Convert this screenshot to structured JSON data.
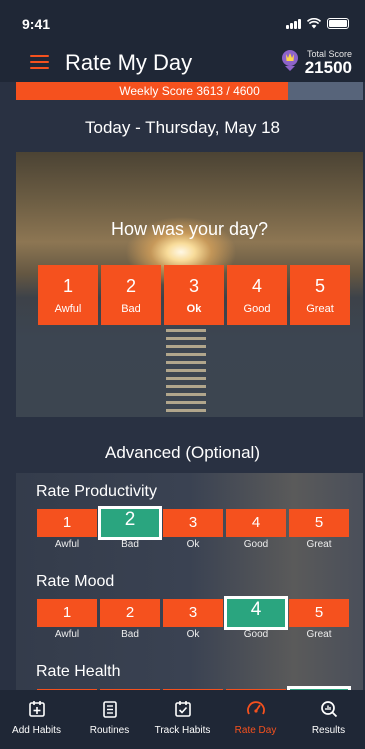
{
  "status": {
    "time": "9:41"
  },
  "header": {
    "title": "Rate My Day",
    "score_label": "Total Score",
    "score_value": "21500"
  },
  "weekly": {
    "label": "Weekly Score  3613 / 4600",
    "progress": 0.785
  },
  "today": "Today - Thursday, May 18",
  "hero": {
    "question": "How was your day?",
    "selected": 3,
    "ratings": [
      {
        "num": "1",
        "label": "Awful"
      },
      {
        "num": "2",
        "label": "Bad"
      },
      {
        "num": "3",
        "label": "Ok"
      },
      {
        "num": "4",
        "label": "Good"
      },
      {
        "num": "5",
        "label": "Great"
      }
    ]
  },
  "advanced": "Advanced (Optional)",
  "sections": [
    {
      "title": "Rate Productivity",
      "selected": 2,
      "nums": [
        "1",
        "2",
        "3",
        "4",
        "5"
      ],
      "labels": [
        "Awful",
        "Bad",
        "Ok",
        "Good",
        "Great"
      ]
    },
    {
      "title": "Rate Mood",
      "selected": 4,
      "nums": [
        "1",
        "2",
        "3",
        "4",
        "5"
      ],
      "labels": [
        "Awful",
        "Bad",
        "Ok",
        "Good",
        "Great"
      ]
    },
    {
      "title": "Rate Health",
      "selected": 5
    }
  ],
  "tabs": [
    {
      "label": "Add Habits",
      "icon": "calendar-plus-icon"
    },
    {
      "label": "Routines",
      "icon": "checklist-icon"
    },
    {
      "label": "Track Habits",
      "icon": "calendar-check-icon"
    },
    {
      "label": "Rate Day",
      "icon": "speedometer-icon",
      "active": true
    },
    {
      "label": "Results",
      "icon": "chart-magnifier-icon"
    }
  ],
  "colors": {
    "accent": "#f5511e",
    "selected": "#2aa57f",
    "background": "#293142",
    "bar": "#1f2736"
  }
}
